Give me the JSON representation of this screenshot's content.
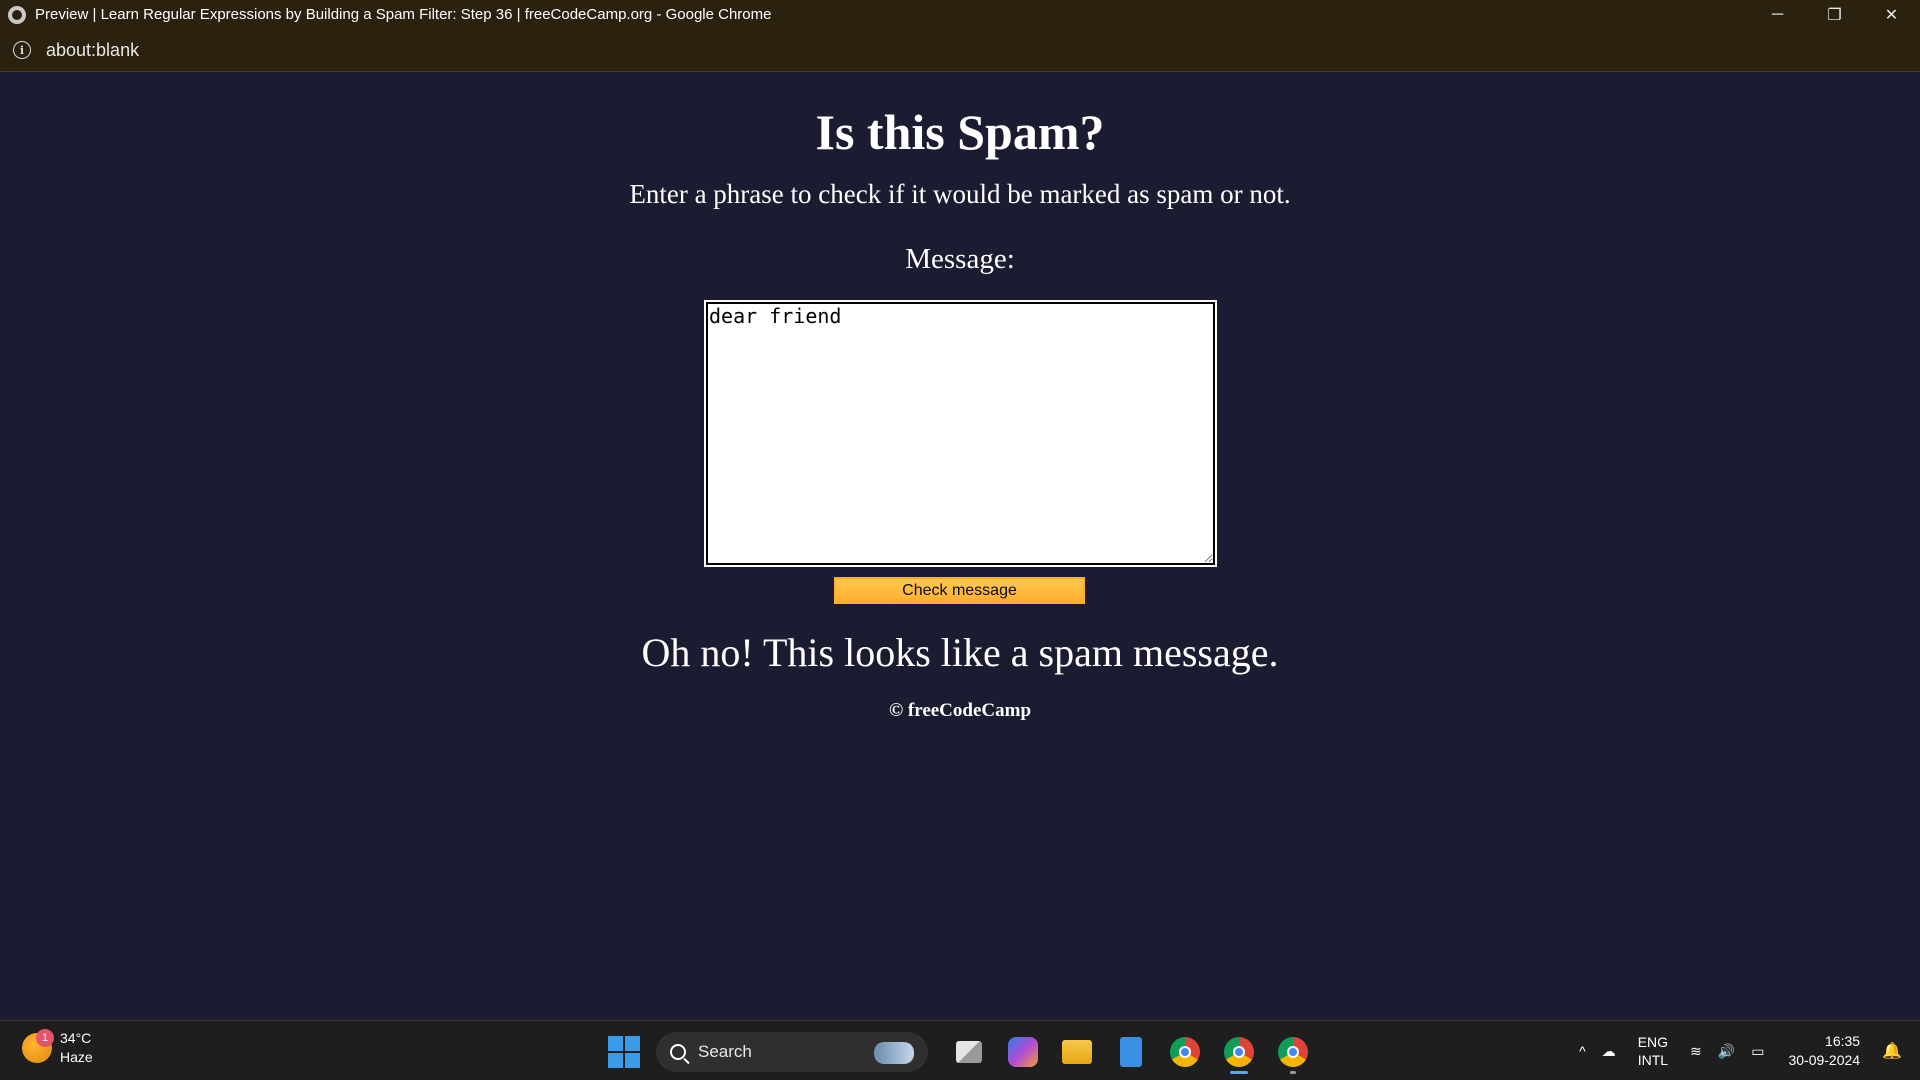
{
  "window": {
    "title": "Preview | Learn Regular Expressions by Building a Spam Filter: Step 36 | freeCodeCamp.org - Google Chrome",
    "minimize_glyph": "─",
    "restore_glyph": "❐",
    "close_glyph": "✕"
  },
  "addressbar": {
    "info_glyph": "i",
    "url": "about:blank"
  },
  "page": {
    "heading": "Is this Spam?",
    "description": "Enter a phrase to check if it would be marked as spam or not.",
    "message_label": "Message:",
    "message_value": "dear friend",
    "check_button": "Check message",
    "result": "Oh no! This looks like a spam message.",
    "footer": "© freeCodeCamp"
  },
  "taskbar": {
    "weather": {
      "badge": "1",
      "temp": "34°C",
      "condition": "Haze"
    },
    "search_label": "Search",
    "apps": [
      {
        "name": "task-view",
        "icon": "task-view-icon"
      },
      {
        "name": "copilot",
        "icon": "copilot-icon"
      },
      {
        "name": "file-explorer",
        "icon": "folder-icon"
      },
      {
        "name": "notepad",
        "icon": "notepad-icon"
      },
      {
        "name": "chrome",
        "icon": "chrome-icon"
      },
      {
        "name": "chrome-active",
        "icon": "chrome-icon"
      },
      {
        "name": "chrome-other",
        "icon": "chrome-icon"
      }
    ],
    "tray": {
      "chevron_glyph": "^",
      "cloud_glyph": "☁",
      "lang_line1": "ENG",
      "lang_line2": "INTL",
      "wifi_glyph": "≋",
      "volume_glyph": "🔊",
      "battery_glyph": "▭",
      "time": "16:35",
      "date": "30-09-2024",
      "bell_glyph": "🔔"
    }
  }
}
